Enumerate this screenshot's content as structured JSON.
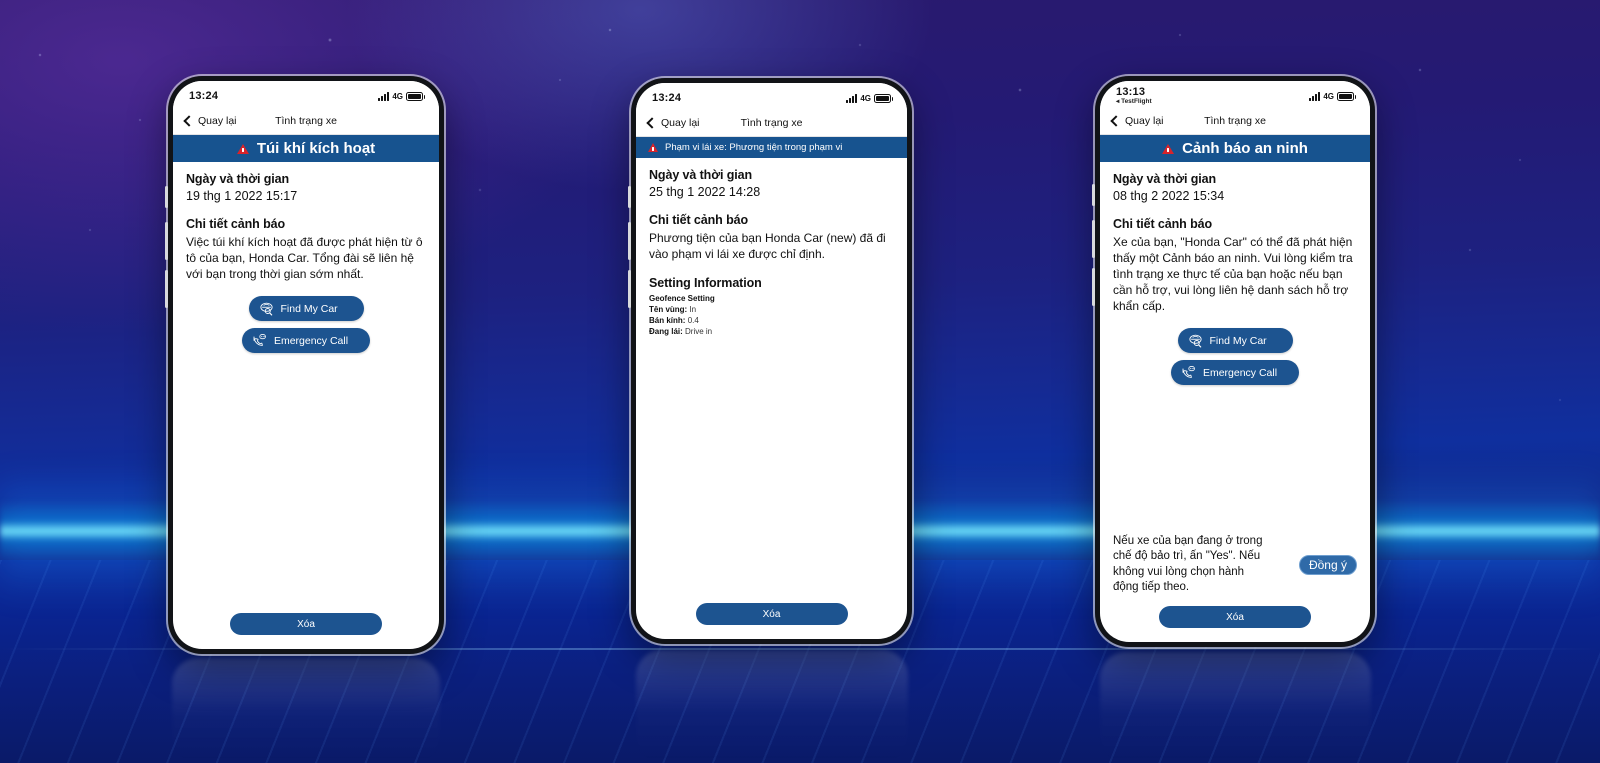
{
  "background": {
    "accent_cyan": "#78ebff",
    "deep_blue": "#0f2f9e",
    "purple": "#6834aa"
  },
  "theme": {
    "banner_blue": "#17538f",
    "button_blue": "#1d5490",
    "warning_red": "#d8232a"
  },
  "phones": [
    {
      "status": {
        "time": "13:24",
        "network": "4G",
        "testflight": ""
      },
      "nav": {
        "back": "Quay lại",
        "title": "Tình trạng xe"
      },
      "banner": {
        "title": "Túi khí kích hoạt",
        "align": "center"
      },
      "datetime_label": "Ngày và thời gian",
      "datetime_value": "19 thg 1 2022 15:17",
      "detail_label": "Chi tiết cảnh báo",
      "detail_text": "Việc túi khí kích hoạt đã được phát hiện từ ô tô của bạn, Honda Car. Tổng đài sẽ liên hệ với bạn trong thời gian sớm nhất.",
      "buttons": {
        "find_my_car": "Find My Car",
        "emergency_call": "Emergency Call"
      },
      "delete": "Xóa"
    },
    {
      "status": {
        "time": "13:24",
        "network": "4G",
        "testflight": ""
      },
      "nav": {
        "back": "Quay lại",
        "title": "Tình trạng xe"
      },
      "banner": {
        "title": "Phạm vi lái xe: Phương tiện trong phạm vi",
        "align": "left"
      },
      "datetime_label": "Ngày và thời gian",
      "datetime_value": "25 thg 1 2022 14:28",
      "detail_label": "Chi tiết cảnh báo",
      "detail_text": "Phương tiện của bạn Honda Car (new) đã đi vào phạm vi lái xe được chỉ định.",
      "setting_title": "Setting Information",
      "setting_sub": "Geofence Setting",
      "setting_rows": [
        {
          "label": "Tên vùng:",
          "value": "In"
        },
        {
          "label": "Bán kính:",
          "value": "0.4"
        },
        {
          "label": "Đang lái:",
          "value": "Drive in"
        }
      ],
      "delete": "Xóa"
    },
    {
      "status": {
        "time": "13:13",
        "network": "4G",
        "testflight": "TestFlight"
      },
      "nav": {
        "back": "Quay lại",
        "title": "Tình trạng xe"
      },
      "banner": {
        "title": "Cảnh báo an ninh",
        "align": "center"
      },
      "datetime_label": "Ngày và thời gian",
      "datetime_value": "08 thg 2 2022 15:34",
      "detail_label": "Chi tiết cảnh báo",
      "detail_text": "Xe của bạn, \"Honda Car\" có thể đã phát hiện thấy một Cảnh báo an ninh. Vui lòng kiểm tra tình trạng xe thực tế của bạn hoặc nếu bạn cần hỗ trợ, vui lòng liên hệ danh sách hỗ trợ khẩn cấp.",
      "buttons": {
        "find_my_car": "Find My Car",
        "emergency_call": "Emergency Call"
      },
      "consent_text": "Nếu xe của bạn đang ở trong chế độ bảo trì, ấn \"Yes\". Nếu không vui lòng chọn hành động tiếp theo.",
      "agree": "Đồng ý",
      "delete": "Xóa"
    }
  ],
  "icons": {
    "back_chevron": "chevron-left-icon",
    "warning": "warning-triangle-icon",
    "find_car": "car-magnifier-icon",
    "emergency": "phone-message-icon",
    "signal": "signal-bars-icon",
    "battery": "battery-icon"
  }
}
